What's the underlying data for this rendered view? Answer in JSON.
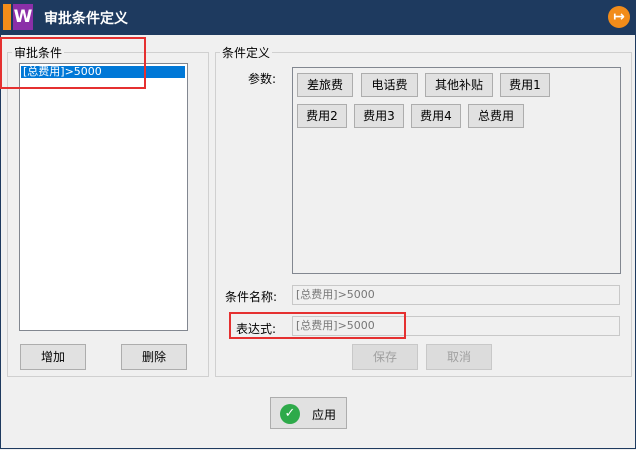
{
  "window": {
    "title": "审批条件定义",
    "icon_letter": "W"
  },
  "left_panel": {
    "legend": "审批条件",
    "items": [
      "[总费用]>5000"
    ],
    "add_label": "增加",
    "delete_label": "删除"
  },
  "right_panel": {
    "legend": "条件定义",
    "params_label": "参数:",
    "params": [
      "差旅费",
      "电话费",
      "其他补贴",
      "费用1",
      "费用2",
      "费用3",
      "费用4",
      "总费用"
    ],
    "name_label": "条件名称:",
    "name_value": "[总费用]>5000",
    "expr_label": "表达式:",
    "expr_value": "[总费用]>5000",
    "save_label": "保存",
    "cancel_label": "取消"
  },
  "footer": {
    "apply_label": "应用"
  },
  "colors": {
    "titlebar": "#1e3a5f",
    "accent_orange": "#f28c1a",
    "highlight_red": "#e53030",
    "selection_blue": "#0078d7"
  },
  "icons": {
    "close": "exit-icon",
    "apply": "check-icon"
  }
}
